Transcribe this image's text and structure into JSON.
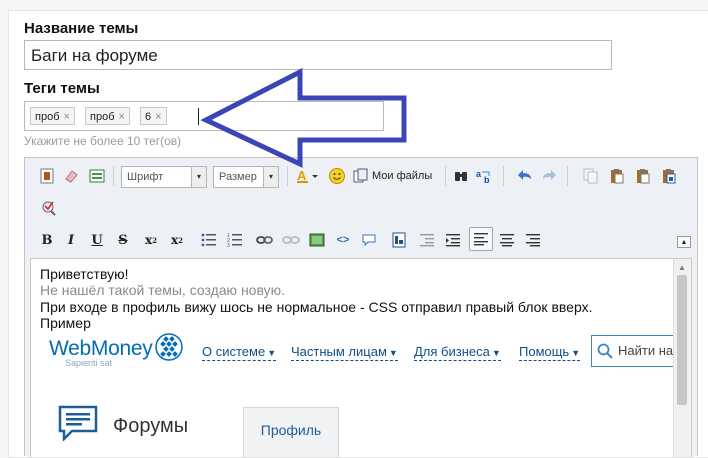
{
  "form": {
    "topic_label": "Название темы",
    "topic_value": "Баги на форуме",
    "tags_label": "Теги темы",
    "tags": [
      "проб",
      "проб",
      "6"
    ],
    "tag_remove": "×",
    "tags_hint": "Укажите не более 10 тег(ов)"
  },
  "toolbar": {
    "font_select": "Шрифт",
    "size_select": "Размер",
    "dropdown_glyph": "▾",
    "my_files": "Мои файлы",
    "icons_row1": [
      "source-icon",
      "eraser-icon",
      "templates-icon",
      "text-color-icon",
      "smiley-icon",
      "my-files-icon",
      "find-icon",
      "replace-icon",
      "undo-icon",
      "redo-icon",
      "copy-icon",
      "paste-icon",
      "paste-text-icon",
      "paste-word-icon"
    ],
    "icons_row2": [
      "spell-check-icon"
    ],
    "icons_row3": [
      "bold-icon",
      "italic-icon",
      "underline-icon",
      "strike-icon",
      "subscript-icon",
      "superscript-icon",
      "bullet-list-icon",
      "numbered-list-icon",
      "link-icon",
      "unlink-icon",
      "image-icon",
      "code-icon",
      "quote-icon",
      "spoiler-icon",
      "outdent-icon",
      "indent-icon",
      "align-left-icon",
      "align-center-icon",
      "align-right-icon",
      "collapse-icon"
    ]
  },
  "editor": {
    "lines": [
      "Приветствую!",
      "Не нашёл такой темы, создаю новую.",
      "При входе в профиль вижу шось не нормальное - CSS отправил правый блок вверх.",
      "Пример"
    ],
    "screenshot": {
      "logo": "WebMoney",
      "logo_sub": "Sapienti sat",
      "nav": [
        "О системе",
        "Частным лицам",
        "Для бизнеса",
        "Помощь"
      ],
      "nav_arrow": "▼",
      "search_placeholder": "Найти на",
      "forums_title": "Форумы",
      "profile_tab": "Профиль"
    }
  },
  "colors": {
    "annotation_arrow": "#3a45b6",
    "link": "#0f4e8c",
    "brand": "#036cb4"
  }
}
